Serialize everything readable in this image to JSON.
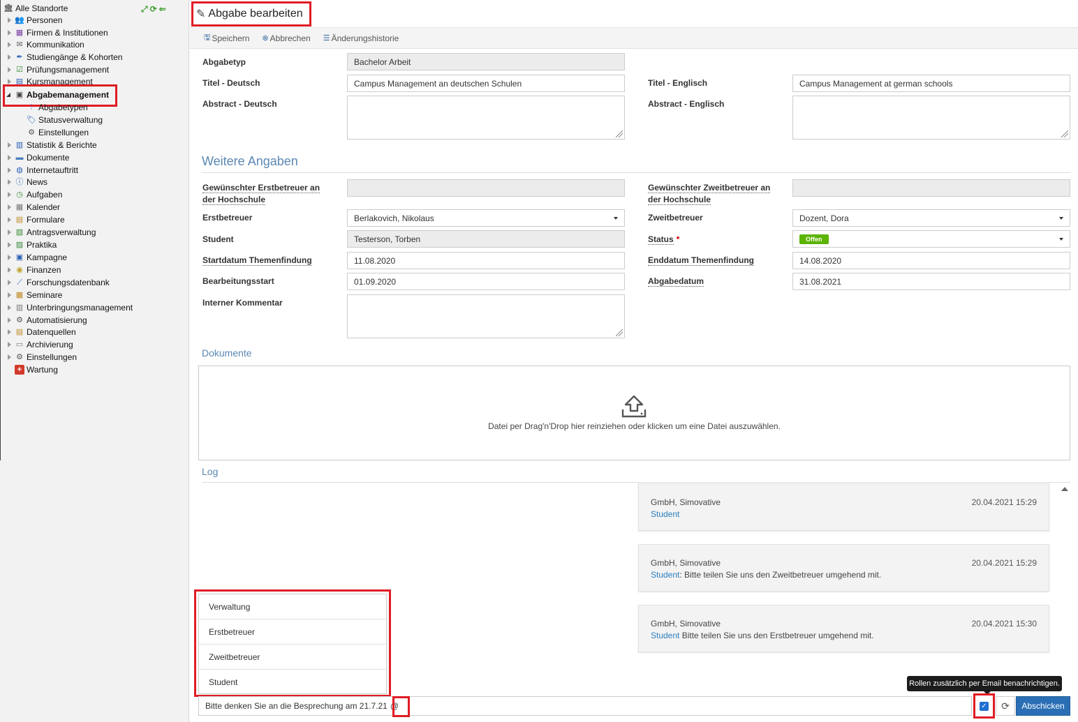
{
  "sidebar": {
    "root": "Alle Standorte",
    "items": [
      {
        "label": "Personen"
      },
      {
        "label": "Firmen & Institutionen"
      },
      {
        "label": "Kommunikation"
      },
      {
        "label": "Studiengänge & Kohorten"
      },
      {
        "label": "Prüfungsmanagement"
      },
      {
        "label": "Kursmanagement"
      },
      {
        "label": "Abgabemanagement"
      },
      {
        "label": "Abgabetypen"
      },
      {
        "label": "Statusverwaltung"
      },
      {
        "label": "Einstellungen"
      },
      {
        "label": "Statistik & Berichte"
      },
      {
        "label": "Dokumente"
      },
      {
        "label": "Internetauftritt"
      },
      {
        "label": "News"
      },
      {
        "label": "Aufgaben"
      },
      {
        "label": "Kalender"
      },
      {
        "label": "Formulare"
      },
      {
        "label": "Antragsverwaltung"
      },
      {
        "label": "Praktika"
      },
      {
        "label": "Kampagne"
      },
      {
        "label": "Finanzen"
      },
      {
        "label": "Forschungsdatenbank"
      },
      {
        "label": "Seminare"
      },
      {
        "label": "Unterbringungsmanagement"
      },
      {
        "label": "Automatisierung"
      },
      {
        "label": "Datenquellen"
      },
      {
        "label": "Archivierung"
      },
      {
        "label": "Einstellungen"
      },
      {
        "label": "Wartung"
      }
    ]
  },
  "header": {
    "title": "Abgabe bearbeiten"
  },
  "toolbar": {
    "save": "Speichern",
    "cancel": "Abbrechen",
    "history": "Änderungshistorie"
  },
  "form": {
    "abgabetyp": {
      "label": "Abgabetyp",
      "value": "Bachelor Arbeit"
    },
    "titel_de": {
      "label": "Titel - Deutsch",
      "value": "Campus Management an deutschen Schulen"
    },
    "titel_en": {
      "label": "Titel - Englisch",
      "value": "Campus Management at german schools"
    },
    "abstract_de": {
      "label": "Abstract - Deutsch",
      "value": ""
    },
    "abstract_en": {
      "label": "Abstract - Englisch",
      "value": ""
    }
  },
  "weitere": {
    "heading": "Weitere Angaben",
    "wunsch_erst": {
      "label_1": "Gewünschter Erstbetreuer an",
      "label_2": "der Hochschule",
      "value": ""
    },
    "wunsch_zweit": {
      "label_1": "Gewünschter Zweitbetreuer an",
      "label_2": "der Hochschule",
      "value": ""
    },
    "erstbetreuer": {
      "label": "Erstbetreuer",
      "value": "Berlakovich, Nikolaus"
    },
    "zweitbetreuer": {
      "label": "Zweitbetreuer",
      "value": "Dozent, Dora"
    },
    "student": {
      "label": "Student",
      "value": "Testerson, Torben"
    },
    "status": {
      "label": "Status",
      "required_mark": "*",
      "value": "Offen",
      "color": "#5bb400"
    },
    "startdatum": {
      "label": "Startdatum Themenfindung",
      "value": "11.08.2020"
    },
    "enddatum": {
      "label": "Enddatum Themenfindung",
      "value": "14.08.2020"
    },
    "bearbeitungsstart": {
      "label": "Bearbeitungsstart",
      "value": "01.09.2020"
    },
    "abgabedatum": {
      "label": "Abgabedatum",
      "value": "31.08.2021"
    },
    "kommentar": {
      "label": "Interner Kommentar",
      "value": ""
    }
  },
  "dokumente": {
    "heading": "Dokumente",
    "drop_text": "Datei per Drag'n'Drop hier reinziehen oder klicken um eine Datei auszuwählen."
  },
  "log": {
    "heading": "Log",
    "entries": [
      {
        "author": "GmbH, Simovative",
        "time": "20.04.2021 15:29",
        "role": "Student",
        "text": ""
      },
      {
        "author": "GmbH, Simovative",
        "time": "20.04.2021 15:29",
        "role": "Student",
        "text": ": Bitte teilen Sie uns den Zweitbetreuer umgehend mit."
      },
      {
        "author": "GmbH, Simovative",
        "time": "20.04.2021 15:30",
        "role": "Student",
        "text": " Bitte teilen Sie uns den Erstbetreuer umgehend mit."
      }
    ],
    "mention_options": [
      "Verwaltung",
      "Erstbetreuer",
      "Zweitbetreuer",
      "Student"
    ],
    "input_value": "Bitte denken Sie an die Besprechung am 21.7.21",
    "at_sign": "@",
    "tooltip": "Rollen zusätzlich per Email benachrichtigen.",
    "send": "Abschicken"
  },
  "colors": {
    "accent": "#2a6fb5",
    "highlight": "#e01c24",
    "link": "#2a7fc0",
    "section": "#5b87b3"
  }
}
